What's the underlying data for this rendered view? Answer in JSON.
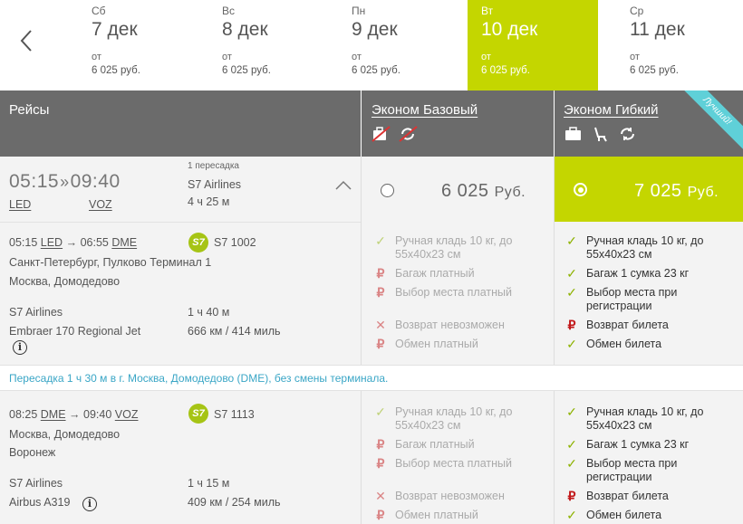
{
  "dates": [
    {
      "dow": "Сб",
      "date": "7 дек",
      "from": "от",
      "price": "6 025 руб."
    },
    {
      "dow": "Вс",
      "date": "8 дек",
      "from": "от",
      "price": "6 025 руб."
    },
    {
      "dow": "Пн",
      "date": "9 дек",
      "from": "от",
      "price": "6 025 руб."
    },
    {
      "dow": "Вт",
      "date": "10 дек",
      "from": "от",
      "price": "6 025 руб.",
      "active": true
    },
    {
      "dow": "Ср",
      "date": "11 дек",
      "from": "от",
      "price": "6 025 руб."
    }
  ],
  "header": {
    "flights": "Рейсы",
    "fare_basic": "Эконом Базовый",
    "fare_flex": "Эконом Гибкий",
    "ribbon": "Лучший!"
  },
  "summary": {
    "dep_time": "05:15",
    "arr_time": "09:40",
    "dep_iata": "LED",
    "arr_iata": "VOZ",
    "stops": "1 пересадка",
    "airline": "S7 Airlines",
    "duration": "4 ч 25 м"
  },
  "prices": {
    "basic": "6 025",
    "flex": "7 025",
    "currency": "Руб."
  },
  "segments": [
    {
      "dep_time": "05:15",
      "dep_iata": "LED",
      "arr_time": "06:55",
      "arr_iata": "DME",
      "logo": "S7",
      "flight_no": "S7 1002",
      "from_airport": "Санкт-Петербург, Пулково Терминал 1",
      "to_airport": "Москва, Домодедово",
      "airline": "S7 Airlines",
      "aircraft": "Embraer 170 Regional Jet",
      "duration": "1 ч 40 м",
      "distance": "666 км / 414 миль"
    },
    {
      "dep_time": "08:25",
      "dep_iata": "DME",
      "arr_time": "09:40",
      "arr_iata": "VOZ",
      "logo": "S7",
      "flight_no": "S7 1113",
      "from_airport": "Москва, Домодедово",
      "to_airport": "Воронеж",
      "airline": "S7 Airlines",
      "aircraft": "Airbus A319",
      "duration": "1 ч 15 м",
      "distance": "409 км / 254 миль"
    }
  ],
  "transfer": "Пересадка 1 ч 30 м в г. Москва, Домодедово (DME), без смены терминала.",
  "basic_features": [
    {
      "icon": "check",
      "text": "Ручная кладь 10 кг, до 55x40x23 см"
    },
    {
      "icon": "ruble",
      "text": "Багаж платный"
    },
    {
      "icon": "ruble",
      "text": "Выбор места платный"
    },
    {
      "icon": "cross",
      "text": "Возврат невозможен"
    },
    {
      "icon": "ruble",
      "text": "Обмен платный"
    }
  ],
  "flex_features": [
    {
      "icon": "check",
      "text": "Ручная кладь 10 кг, до 55x40x23 см"
    },
    {
      "icon": "check",
      "text": "Багаж 1 сумка 23 кг"
    },
    {
      "icon": "check",
      "text": "Выбор места при регистрации"
    },
    {
      "icon": "ruble",
      "text": "Возврат билета"
    },
    {
      "icon": "check",
      "text": "Обмен билета"
    }
  ],
  "colors": {
    "accent": "#c4d600",
    "header": "#6b6b6b",
    "link": "#3aa6c6",
    "ruble": "#c2181a"
  }
}
